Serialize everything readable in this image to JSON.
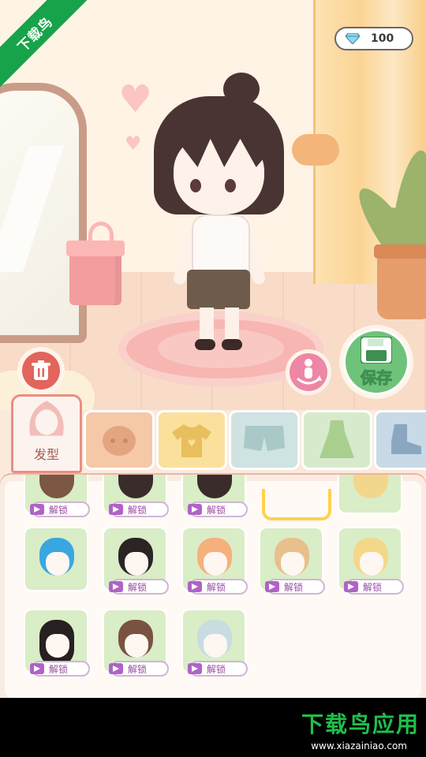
{
  "watermark": {
    "ribbon": "下载鸟",
    "brand": "下载鸟应用",
    "url": "www.xiazainiao.com"
  },
  "currency": {
    "icon": "diamond-icon",
    "amount": "100"
  },
  "buttons": {
    "save_label": "保存",
    "trash_icon": "trash-icon",
    "pose_icon": "pose-rotate-icon"
  },
  "tabs": [
    {
      "label": "发型",
      "icon": "hair-icon",
      "active": true
    },
    {
      "label": "",
      "icon": "face-icon"
    },
    {
      "label": "",
      "icon": "shirt-icon"
    },
    {
      "label": "",
      "icon": "shorts-icon"
    },
    {
      "label": "",
      "icon": "dress-icon"
    },
    {
      "label": "",
      "icon": "shoe-icon"
    }
  ],
  "items": {
    "unlock_label": "解锁",
    "rows": [
      [
        "brown-hair",
        "dark-hair",
        "dark-hair",
        "selected",
        "blonde-hair"
      ],
      [
        "blue-hair",
        "black-yellow-hair",
        "orange-ponytail-hair",
        "blonde-messy-hair",
        "blonde-curly-hair"
      ],
      [
        "black-long-hair",
        "brown-hair",
        "silver-hair"
      ]
    ]
  }
}
